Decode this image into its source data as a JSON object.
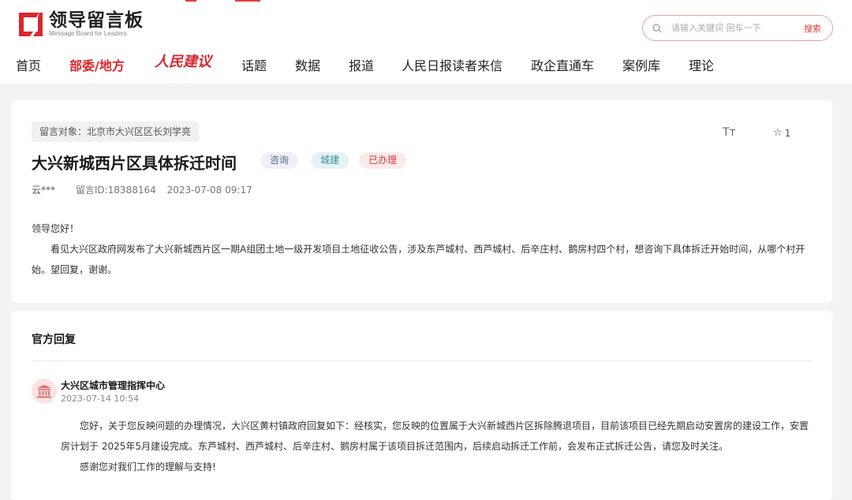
{
  "header": {
    "logo_title": "领导留言板",
    "logo_subtitle": "Message Board for Leaders",
    "search": {
      "placeholder": "请输入关键词 回车一下",
      "button": "搜索"
    },
    "nav": [
      "首页",
      "部委/地方",
      "人民建议",
      "话题",
      "数据",
      "报道",
      "人民日报读者来信",
      "政企直通车",
      "案例库",
      "理论"
    ],
    "nav_active": "部委/地方"
  },
  "message": {
    "target": "留言对象：北京市大兴区区长刘学亮",
    "font_size_label": "Tт",
    "star_count": "1",
    "title": "大兴新城西片区具体拆迁时间",
    "tags": [
      "咨询",
      "城建",
      "已办理"
    ],
    "author": "云***",
    "message_id": "留言ID:18388164",
    "datetime": "2023-07-08 09:17",
    "greeting": "领导您好！",
    "body": "看见大兴区政府网发布了大兴新城西片区一期A组团土地一级开发项目土地征收公告，涉及东芦城村、西芦城村、后辛庄村、鹅房村四个村，想咨询下具体拆迁开始时间，从哪个村开始。望回复，谢谢。"
  },
  "reply": {
    "section_title": "官方回复",
    "department": "大兴区城市管理指挥中心",
    "datetime": "2023-07-14 10:54",
    "paragraph1": "您好，关于您反映问题的办理情况，大兴区黄村镇政府回复如下：经核实，您反映的位置属于大兴新城西片区拆除腾退项目，目前该项目已经先期启动安置房的建设工作，安置房计划于 2025年5月建设完成。东芦城村、西芦城村、后辛庄村、鹅房村属于该项目拆迁范围内，后续启动拆迁工作前，会发布正式拆迁公告，请您及时关注。",
    "paragraph2": "感谢您对我们工作的理解与支持!"
  },
  "colors": {
    "brand_red": "#d7282e",
    "tag_ask": "#5d6c8c",
    "tag_city": "#3d8ea2",
    "tag_done": "#d53b3b"
  },
  "icons": {
    "logo": "logo-icon",
    "search": "search-icon",
    "star": "star-icon",
    "department": "government-building-icon"
  }
}
